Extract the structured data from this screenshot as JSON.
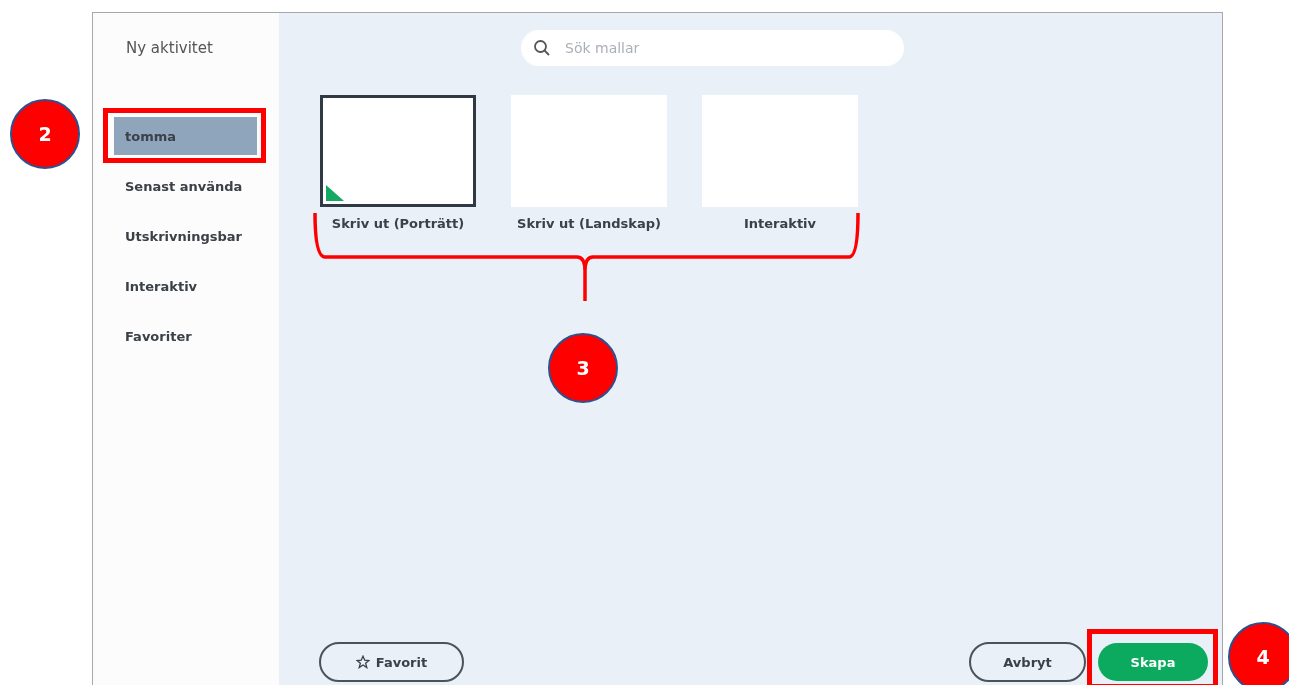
{
  "sidebar": {
    "title": "Ny aktivitet",
    "items": [
      {
        "label": "tomma",
        "selected": true
      },
      {
        "label": "Senast använda",
        "selected": false
      },
      {
        "label": "Utskrivningsbar",
        "selected": false
      },
      {
        "label": "Interaktiv",
        "selected": false
      },
      {
        "label": "Favoriter",
        "selected": false
      }
    ]
  },
  "search": {
    "placeholder": "Sök mallar"
  },
  "templates": [
    {
      "label": "Skriv ut (Porträtt)",
      "selected": true
    },
    {
      "label": "Skriv ut (Landskap)",
      "selected": false
    },
    {
      "label": "Interaktiv",
      "selected": false
    }
  ],
  "buttons": {
    "favorite": "Favorit",
    "cancel": "Avbryt",
    "create": "Skapa"
  },
  "callouts": [
    "2",
    "3",
    "4"
  ]
}
